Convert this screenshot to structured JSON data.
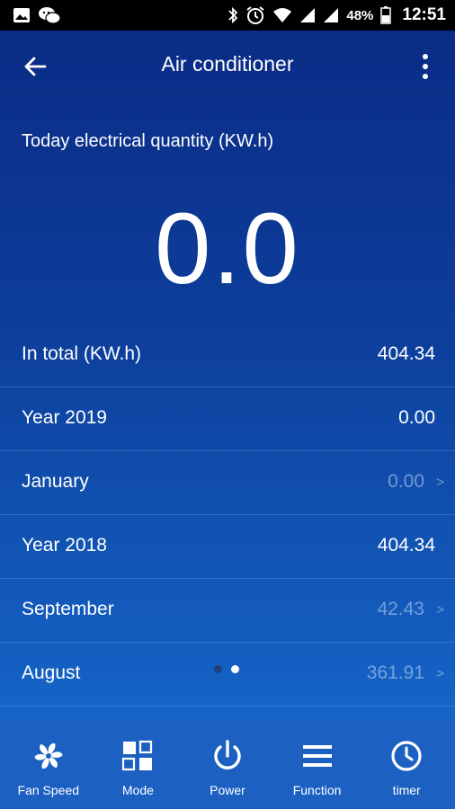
{
  "status_bar": {
    "battery": "48%",
    "time": "12:51",
    "icons": [
      "image-icon",
      "wechat-icon",
      "bluetooth-icon",
      "alarm-icon",
      "wifi-icon",
      "signal-icon",
      "signal-icon",
      "battery-icon"
    ]
  },
  "app_bar": {
    "title": "Air conditioner",
    "back_icon": "arrow-left-icon",
    "menu_icon": "more-vert-icon"
  },
  "today": {
    "label": "Today electrical quantity (KW.h)",
    "value": "0.0"
  },
  "rows": [
    {
      "label": "In total (KW.h)",
      "value": "404.34",
      "chevron": ""
    },
    {
      "label": "Year 2019",
      "value": "0.00",
      "chevron": ""
    },
    {
      "label": "January",
      "value": "0.00",
      "chevron": ">"
    },
    {
      "label": "Year 2018",
      "value": "404.34",
      "chevron": ""
    },
    {
      "label": "September",
      "value": "42.43",
      "chevron": ">"
    },
    {
      "label": "August",
      "value": "361.91",
      "chevron": ">"
    }
  ],
  "pager": {
    "pages": 2,
    "current": 2
  },
  "bottom_nav": [
    {
      "label": "Fan Speed",
      "icon": "fan-icon"
    },
    {
      "label": "Mode",
      "icon": "mode-grid-icon"
    },
    {
      "label": "Power",
      "icon": "power-icon"
    },
    {
      "label": "Function",
      "icon": "menu-lines-icon"
    },
    {
      "label": "timer",
      "icon": "clock-icon"
    }
  ],
  "colors": {
    "status_bar": "#000000",
    "background_top": "#0a2c86",
    "background_bottom": "#1565c8",
    "bottom_nav": "#1c61c2",
    "text": "#ffffff",
    "muted_value": "#8fa8d8"
  }
}
